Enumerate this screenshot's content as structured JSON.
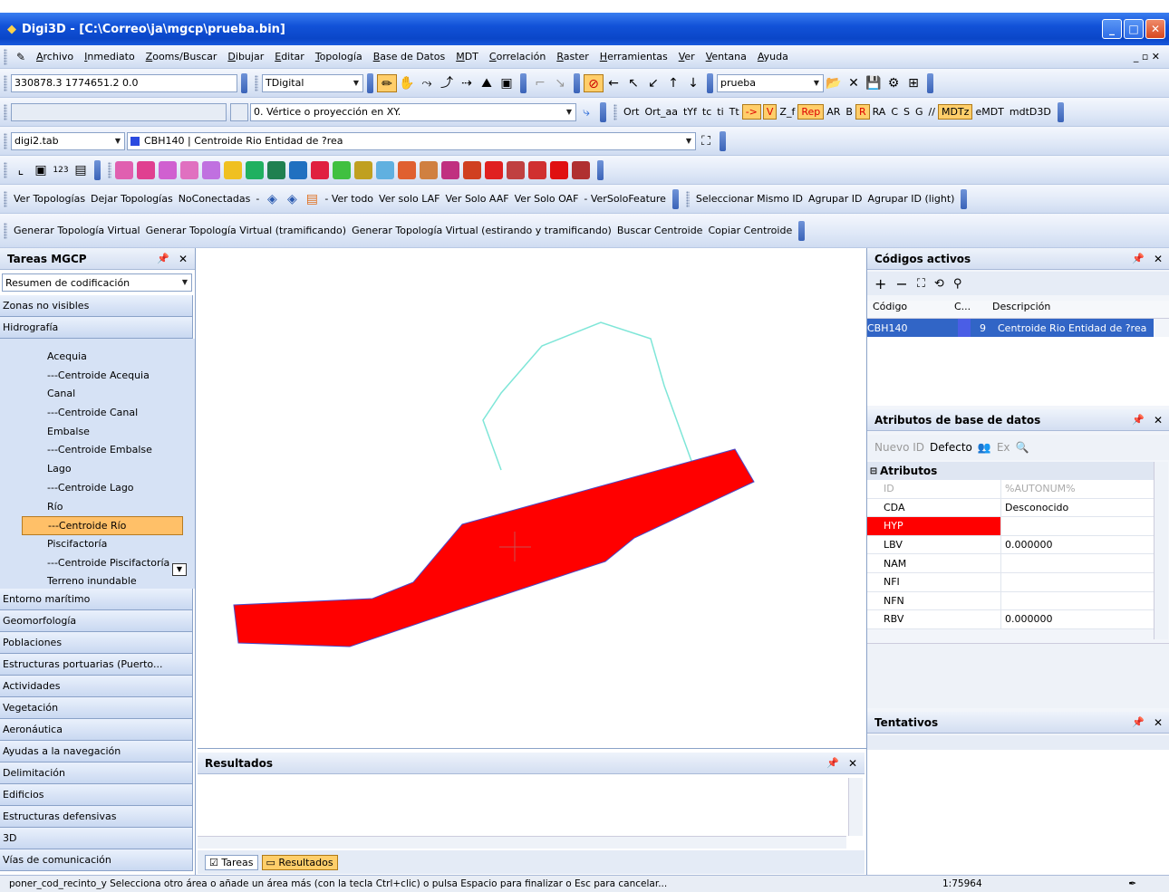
{
  "window": {
    "title": "Digi3D - [C:\\Correo\\ja\\mgcp\\prueba.bin]",
    "minimize": "_",
    "maximize": "□",
    "close": "✕"
  },
  "menu": [
    "Archivo",
    "Inmediato",
    "Zooms/Buscar",
    "Dibujar",
    "Editar",
    "Topología",
    "Base de Datos",
    "MDT",
    "Correlación",
    "Raster",
    "Herramientas",
    "Ver",
    "Ventana",
    "Ayuda"
  ],
  "menu_controls": "_ ▫ ✕",
  "toolbar2": {
    "coords": "330878.3 1774651.2 0.0",
    "mode": "TDigital",
    "layer": "prueba"
  },
  "toolbar3": {
    "snap_mode": "0. Vértice o proyección en XY.",
    "buttons": [
      "Ort",
      "Ort_aa",
      "tYf",
      "tc",
      "ti",
      "Tt",
      "->",
      "V",
      "Z_f",
      "Rep",
      "AR",
      "B",
      "R",
      "RA",
      "C",
      "S",
      "G",
      "//",
      "MDTz",
      "eMDT",
      "mdtD3D"
    ]
  },
  "toolbar4": {
    "table": "digi2.tab",
    "code": "CBH140 | Centroide Rio Entidad de ?rea"
  },
  "toolbar6": {
    "items": [
      "Ver Topologías",
      "Dejar Topologías",
      "NoConectadas",
      "-",
      "- Ver todo",
      "Ver solo LAF",
      "Ver Solo AAF",
      "Ver Solo OAF",
      "- VerSoloFeature"
    ],
    "items2": [
      "Seleccionar Mismo ID",
      "Agrupar ID",
      "Agrupar ID (light)"
    ]
  },
  "toolbar7": {
    "items": [
      "Generar Topología Virtual",
      "Generar Topología Virtual (tramificando)",
      "Generar Topología Virtual (estirando y tramificando)",
      "Buscar Centroide",
      "Copiar Centroide"
    ]
  },
  "tareas": {
    "title": "Tareas MGCP",
    "summary": "Resumen de codificación",
    "top_categories": [
      "Zonas no visibles",
      "Hidrografía"
    ],
    "hidro_items": [
      "Acequia",
      "---Centroide Acequia",
      "Canal",
      "---Centroide Canal",
      "Embalse",
      "---Centroide Embalse",
      "Lago",
      "---Centroide Lago",
      "Río",
      "---Centroide Río",
      "Piscifactoría",
      "---Centroide Piscifactoría",
      "Terreno inundable"
    ],
    "selected_item": "---Centroide Río",
    "bottom_categories": [
      "Entorno marítimo",
      "Geomorfología",
      "Poblaciones",
      "Estructuras portuarias (Puerto...",
      "Actividades",
      "Vegetación",
      "Aeronáutica",
      "Ayudas a la navegación",
      "Delimitación",
      "Edificios",
      "Estructuras defensivas",
      "3D",
      "Vías de comunicación"
    ]
  },
  "codigos": {
    "title": "Códigos activos",
    "columns": [
      "Código",
      "C...",
      "Descripción"
    ],
    "rows": [
      {
        "code": "CBH140",
        "count": "9",
        "desc": "Centroide Rio Entidad de ?rea"
      }
    ]
  },
  "atributos": {
    "title": "Atributos de base de datos",
    "toolbar": [
      "Nuevo ID",
      "Defecto",
      "Ex"
    ],
    "group": "Atributos",
    "rows": [
      {
        "k": "ID",
        "v": "%AUTONUM%"
      },
      {
        "k": "CDA",
        "v": "Desconocido"
      },
      {
        "k": "HYP",
        "v": ""
      },
      {
        "k": "LBV",
        "v": "0.000000"
      },
      {
        "k": "NAM",
        "v": ""
      },
      {
        "k": "NFI",
        "v": ""
      },
      {
        "k": "NFN",
        "v": ""
      },
      {
        "k": "RBV",
        "v": "0.000000"
      }
    ]
  },
  "tentativos": {
    "title": "Tentativos"
  },
  "resultados": {
    "title": "Resultados",
    "tabs": [
      "Tareas",
      "Resultados"
    ]
  },
  "status": {
    "message": "poner_cod_recinto_y  Selecciona otro área o añade un área más (con la tecla Ctrl+clic) o pulsa Espacio para finalizar o Esc para cancelar...",
    "scale": "1:75964"
  },
  "colors": {
    "polygon_fill": "#ff0000",
    "polygon_outline": "#4a4ac8",
    "cyan_line": "#7fe6d8",
    "selected": "#ffc068",
    "titlebar": "#0a46c8"
  }
}
